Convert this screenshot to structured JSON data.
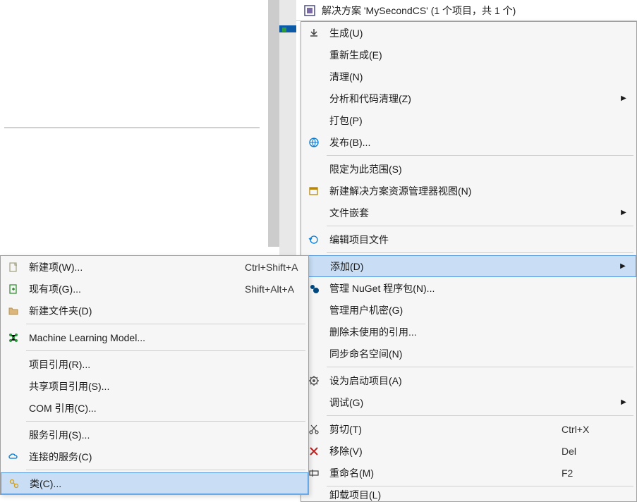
{
  "solution": {
    "title": "解决方案 'MySecondCS' (1 个项目，共 1 个)"
  },
  "rightMenu": {
    "build": "生成(U)",
    "rebuild": "重新生成(E)",
    "clean": "清理(N)",
    "analyze": "分析和代码清理(Z)",
    "pack": "打包(P)",
    "publish": "发布(B)...",
    "scope": "限定为此范围(S)",
    "newView": "新建解决方案资源管理器视图(N)",
    "fileNesting": "文件嵌套",
    "editProject": "编辑项目文件",
    "add": "添加(D)",
    "nuget": "管理 NuGet 程序包(N)...",
    "secrets": "管理用户机密(G)",
    "removeUnused": "删除未使用的引用...",
    "syncNs": "同步命名空间(N)",
    "startup": "设为启动项目(A)",
    "debug": "调试(G)",
    "cut": "剪切(T)",
    "cutKey": "Ctrl+X",
    "remove": "移除(V)",
    "removeKey": "Del",
    "rename": "重命名(M)",
    "renameKey": "F2",
    "unload": "卸载项目(L)"
  },
  "leftMenu": {
    "newItem": "新建项(W)...",
    "newItemKey": "Ctrl+Shift+A",
    "existing": "现有项(G)...",
    "existingKey": "Shift+Alt+A",
    "newFolder": "新建文件夹(D)",
    "mlModel": "Machine Learning Model...",
    "projRef": "项目引用(R)...",
    "sharedRef": "共享项目引用(S)...",
    "comRef": "COM 引用(C)...",
    "svcRef": "服务引用(S)...",
    "connSvc": "连接的服务(C)",
    "class": "类(C)..."
  }
}
